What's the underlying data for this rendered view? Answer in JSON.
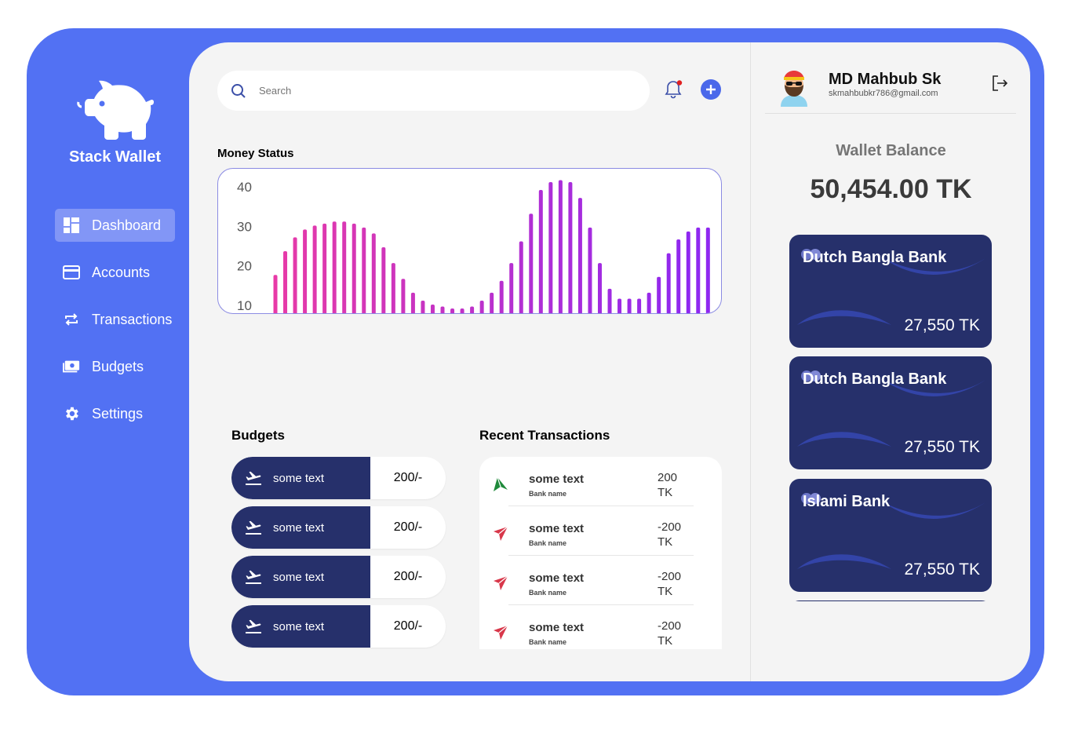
{
  "sidebar": {
    "brand": "Stack Wallet",
    "items": [
      {
        "label": "Dashboard",
        "icon": "dashboard-icon",
        "active": true
      },
      {
        "label": "Accounts",
        "icon": "card-icon",
        "active": false
      },
      {
        "label": "Transactions",
        "icon": "repeat-icon",
        "active": false
      },
      {
        "label": "Budgets",
        "icon": "money-icon",
        "active": false
      },
      {
        "label": "Settings",
        "icon": "gear-icon",
        "active": false
      }
    ]
  },
  "search": {
    "placeholder": "Search"
  },
  "money_status": {
    "title": "Money Status"
  },
  "chart_data": {
    "type": "bar",
    "title": "Money Status",
    "xlabel": "",
    "ylabel": "",
    "ylim": [
      8,
      42
    ],
    "yticks": [
      10,
      20,
      30,
      40
    ],
    "grid": false,
    "values": [
      17.5,
      23.5,
      27,
      29,
      30,
      30.5,
      31,
      31,
      30.5,
      29.5,
      28,
      24.5,
      20.5,
      16.5,
      13,
      11,
      10,
      9.5,
      9,
      9,
      9.5,
      11,
      13,
      16,
      20.5,
      26,
      33,
      39,
      41,
      41.5,
      41,
      37,
      29.5,
      20.5,
      14,
      11.5,
      11.5,
      11.5,
      13,
      17,
      23,
      26.5,
      28.5,
      29.5,
      29.5
    ],
    "colors": {
      "start": "#e83aa7",
      "end": "#8f28f0"
    }
  },
  "budgets": {
    "title": "Budgets",
    "items": [
      {
        "label": "some text",
        "amount": "200/-"
      },
      {
        "label": "some text",
        "amount": "200/-"
      },
      {
        "label": "some text",
        "amount": "200/-"
      },
      {
        "label": "some text",
        "amount": "200/-"
      }
    ]
  },
  "transactions": {
    "title": "Recent Transactions",
    "items": [
      {
        "name": "some text",
        "bank": "Bank name",
        "amount": "200 TK",
        "direction": "in",
        "color": "#1f8a3b"
      },
      {
        "name": "some text",
        "bank": "Bank name",
        "amount": "-200 TK",
        "direction": "out",
        "color": "#d8374a"
      },
      {
        "name": "some text",
        "bank": "Bank name",
        "amount": "-200 TK",
        "direction": "out",
        "color": "#d8374a"
      },
      {
        "name": "some text",
        "bank": "Bank name",
        "amount": "-200 TK",
        "direction": "out",
        "color": "#d8374a"
      }
    ]
  },
  "user": {
    "name": "MD Mahbub Sk",
    "email": "skmahbubkr786@gmail.com"
  },
  "wallet": {
    "label": "Wallet Balance",
    "amount": "50,454.00 TK",
    "cards": [
      {
        "bank": "Dutch Bangla Bank",
        "balance": "27,550 TK"
      },
      {
        "bank": "Dutch Bangla Bank",
        "balance": "27,550 TK"
      },
      {
        "bank": "Islami Bank",
        "balance": "27,550 TK"
      }
    ]
  },
  "colors": {
    "accent": "#5271f3",
    "navy": "#26306b",
    "panel": "#f4f4f4",
    "notification": "#e02020"
  }
}
